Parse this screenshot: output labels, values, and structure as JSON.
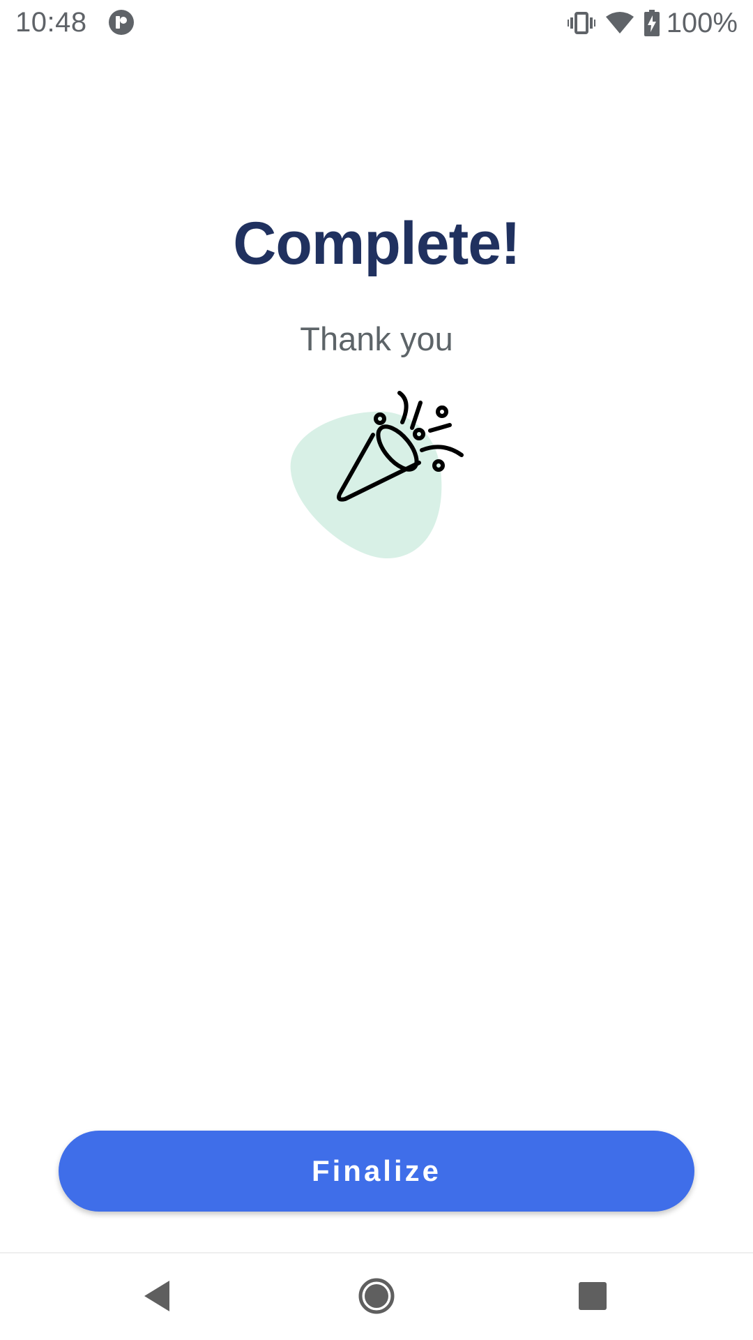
{
  "status_bar": {
    "time": "10:48",
    "battery_percent": "100%",
    "icons": [
      "app-notification-icon",
      "vibrate-icon",
      "wifi-icon",
      "battery-charging-icon"
    ]
  },
  "main": {
    "title": "Complete!",
    "subtitle": "Thank you",
    "illustration": "party-popper-icon"
  },
  "actions": {
    "finalize_label": "Finalize"
  },
  "nav_bar": {
    "items": [
      "back-icon",
      "home-icon",
      "recents-icon"
    ]
  },
  "colors": {
    "title": "#20315f",
    "subtitle": "#5d6468",
    "button": "#3f6ee9",
    "blob": "#d8f0e6"
  }
}
